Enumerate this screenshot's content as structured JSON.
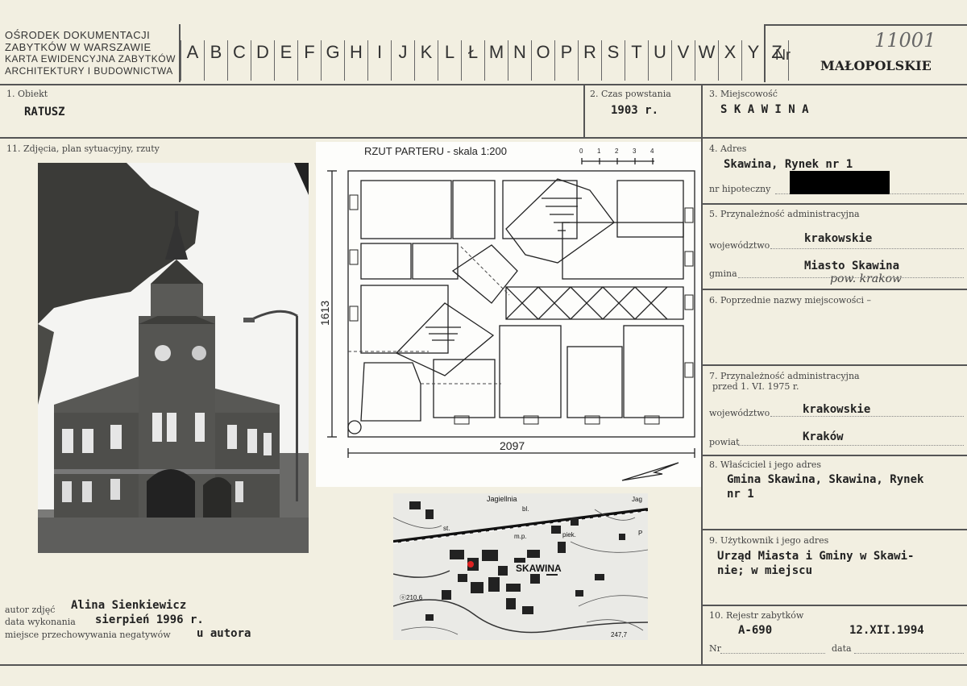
{
  "header": {
    "institution": [
      "OŚRODEK DOKUMENTACJI",
      "ZABYTKÓW W WARSZAWIE",
      "KARTA EWIDENCYJNA ZABYTKÓW",
      "ARCHITEKTURY I BUDOWNICTWA"
    ],
    "letters": [
      "A",
      "B",
      "C",
      "D",
      "E",
      "F",
      "G",
      "H",
      "I",
      "J",
      "K",
      "L",
      "Ł",
      "M",
      "N",
      "O",
      "P",
      "R",
      "S",
      "T",
      "U",
      "V",
      "W",
      "X",
      "Y",
      "Z"
    ],
    "nr_label": "Nr",
    "nr_value": "11001",
    "region": "MAŁOPOLSKIE"
  },
  "fields": {
    "obiekt_label": "1. Obiekt",
    "obiekt_value": "RATUSZ",
    "czas_label": "2. Czas powstania",
    "czas_value": "1903 r.",
    "miejscowosc_label": "3. Miejscowość",
    "miejscowosc_value": "S K A W I N A",
    "zdjecia_label": "11. Zdjęcia, plan sytuacyjny, rzuty",
    "adres_label": "4. Adres",
    "adres_value": "Skawina, Rynek nr 1",
    "hipoteczny_label": "nr hipoteczny",
    "przynaleznosc_label": "5. Przynależność administracyjna",
    "wojewodztwo_label": "województwo",
    "wojewodztwo_value": "krakowskie",
    "gmina_label": "gmina",
    "gmina_value": "Miasto Skawina",
    "gmina_note": "pow. krakow",
    "poprzednie_label": "6. Poprzednie nazwy miejscowości –",
    "przynaleznosc75_label": "7. Przynależność administracyjna",
    "przynaleznosc75_sub": "przed 1. VI. 1975 r.",
    "wojewodztwo75_label": "województwo",
    "wojewodztwo75_value": "krakowskie",
    "powiat_label": "powiat",
    "powiat_value": "Kraków",
    "wlasciciel_label": "8. Właściciel i jego adres",
    "wlasciciel_value": [
      "Gmina Skawina, Skawina, Rynek",
      "nr 1"
    ],
    "uzytkownik_label": "9. Użytkownik i jego adres",
    "uzytkownik_value": [
      "Urząd Miasta i Gminy w Skawi-",
      "nie; w miejscu"
    ],
    "rejestr_label": "10. Rejestr zabytków",
    "rejestr_nr": "A-690",
    "rejestr_data": "12.XII.1994",
    "nr_label_small": "Nr",
    "data_label_small": "data"
  },
  "photo_meta": {
    "autor_label": "autor zdjęć",
    "autor_value": "Alina Sienkiewicz",
    "data_label": "data wykonania",
    "data_value": "sierpień 1996 r.",
    "miejsce_label": "miejsce przechowywania negatywów",
    "miejsce_value": "u autora"
  },
  "plan": {
    "title": "RZUT PARTERU - skala 1:200",
    "scale_ticks": [
      "0",
      "1",
      "2",
      "3",
      "4"
    ],
    "dim_width": "2097",
    "dim_height": "1613"
  },
  "map": {
    "town": "SKAWINA",
    "labels": [
      "Jagiellnia",
      "bl.",
      "st.",
      "m.p.",
      "piek.",
      "ⓞ210,6",
      "247,7",
      "Jag",
      "P"
    ]
  }
}
